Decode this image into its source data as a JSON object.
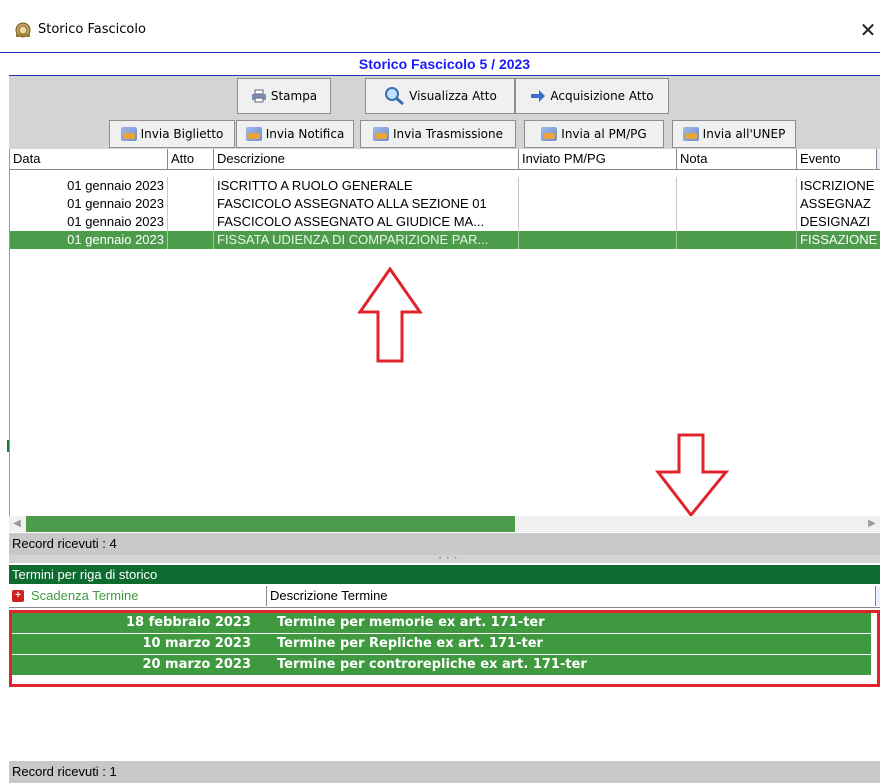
{
  "window": {
    "title": "Storico Fascicolo",
    "close_glyph": "✕",
    "icon": "app-emblem-icon"
  },
  "header": {
    "title": "Storico Fascicolo  5 / 2023"
  },
  "toolbar": {
    "row1": [
      {
        "label": "Stampa",
        "icon": "print-icon"
      },
      {
        "label": "Visualizza Atto",
        "icon": "magnifier-icon"
      },
      {
        "label": "Acquisizione Atto",
        "icon": "acquire-arrow-icon"
      }
    ],
    "row2": [
      {
        "label": "Invia Biglietto",
        "icon": "mail-icon"
      },
      {
        "label": "Invia Notifica",
        "icon": "mail-icon"
      },
      {
        "label": "Invia Trasmissione",
        "icon": "mail-icon"
      },
      {
        "label": "Invia al PM/PG",
        "icon": "mail-icon"
      },
      {
        "label": "Invia all'UNEP",
        "icon": "mail-icon"
      }
    ]
  },
  "history_grid": {
    "columns": [
      "Data",
      "Atto",
      "Descrizione",
      "Inviato PM/PG",
      "Nota",
      "Evento"
    ],
    "rows": [
      {
        "data": "01 gennaio 2023",
        "atto": "",
        "descrizione": "ISCRITTO A RUOLO GENERALE",
        "inviato": "",
        "nota": "",
        "evento": "ISCRIZIONE"
      },
      {
        "data": "01 gennaio 2023",
        "atto": "",
        "descrizione": "FASCICOLO ASSEGNATO ALLA SEZIONE 01",
        "inviato": "",
        "nota": "",
        "evento": "ASSEGNAZ"
      },
      {
        "data": "01 gennaio 2023",
        "atto": "",
        "descrizione": "FASCICOLO ASSEGNATO AL GIUDICE MA...",
        "inviato": "",
        "nota": "",
        "evento": "DESIGNAZI"
      },
      {
        "data": "01 gennaio 2023",
        "atto": "",
        "descrizione": "FISSATA UDIENZA DI COMPARIZIONE PAR...",
        "inviato": "",
        "nota": "",
        "evento": "FISSAZIONE"
      }
    ],
    "selected_row": 3,
    "status": "Record ricevuti : 4"
  },
  "terms_panel": {
    "title": "Termini per riga di storico",
    "columns": [
      "Scadenza Termine",
      "Descrizione Termine"
    ],
    "rows": [
      {
        "scadenza": "18 febbraio 2023",
        "descrizione": "Termine per memorie ex art. 171-ter"
      },
      {
        "scadenza": "10 marzo 2023",
        "descrizione": "Termine per Repliche ex art. 171-ter"
      },
      {
        "scadenza": "20 marzo 2023",
        "descrizione": "Termine per controrepliche ex art. 171-ter"
      }
    ],
    "status": "Record ricevuti : 1"
  },
  "colors": {
    "selection_green": "#4c9c4c",
    "panel_header_green": "#0e6b30",
    "annotation_red": "#e0242c",
    "header_blue": "#1a1aff"
  }
}
